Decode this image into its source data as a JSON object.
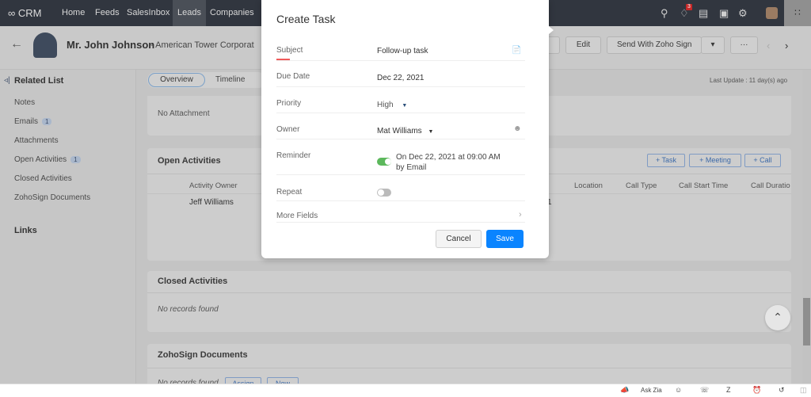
{
  "topbar": {
    "logo": "CRM",
    "nav": [
      "Home",
      "Feeds",
      "SalesInbox",
      "Leads",
      "Companies"
    ],
    "active": "Leads",
    "notification_count": "3"
  },
  "header": {
    "name": "Mr. John Johnson",
    "company": "- American Tower Corporat",
    "edit": "Edit",
    "send_sign": "Send With Zoho Sign",
    "more": "···"
  },
  "tabs": {
    "overview": "Overview",
    "timeline": "Timeline",
    "last_update": "Last Update : 11 day(s) ago"
  },
  "sidebar": {
    "title": "Related List",
    "items": [
      {
        "label": "Notes"
      },
      {
        "label": "Emails",
        "count": "1"
      },
      {
        "label": "Attachments"
      },
      {
        "label": "Open Activities",
        "count": "1"
      },
      {
        "label": "Closed Activities"
      },
      {
        "label": "ZohoSign Documents"
      }
    ],
    "links": "Links"
  },
  "attachments": {
    "empty": "No Attachment"
  },
  "open_activities": {
    "title": "Open Activities",
    "buttons": [
      "+ Task",
      "+ Meeting",
      "+ Call"
    ],
    "columns": [
      "Activity Owner",
      "Location",
      "Call Type",
      "Call Start Time",
      "Call Duratio"
    ],
    "rows": [
      {
        "owner": "Jeff Williams",
        "partial": "1"
      }
    ]
  },
  "closed_activities": {
    "title": "Closed Activities",
    "empty": "No records found"
  },
  "zohosign": {
    "title": "ZohoSign Documents",
    "empty": "No records found",
    "assign": "Assign",
    "new": "New"
  },
  "modal": {
    "title": "Create Task",
    "fields": [
      {
        "label": "Subject",
        "value": "Follow-up task"
      },
      {
        "label": "Due Date",
        "value": "Dec 22, 2021"
      },
      {
        "label": "Priority",
        "value": "High"
      },
      {
        "label": "Owner",
        "value": "Mat Williams"
      },
      {
        "label": "Reminder",
        "value": "On Dec 22, 2021 at 09:00 AM",
        "value2": "by Email",
        "enabled": true
      },
      {
        "label": "Repeat",
        "enabled": false
      },
      {
        "label": "More Fields"
      }
    ],
    "cancel": "Cancel",
    "save": "Save",
    "accent": "#0a84ff",
    "toggle_on": "#5cb85c"
  },
  "bottombar": {
    "ask_zia": "Ask Zia"
  }
}
